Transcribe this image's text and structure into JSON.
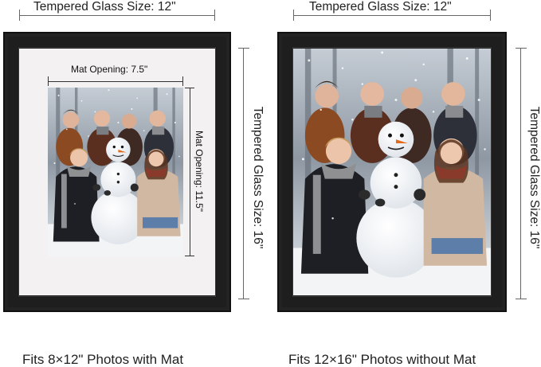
{
  "left": {
    "glass_width_label": "Tempered Glass Size: 12\"",
    "glass_height_label": "Tempered Glass Size: 16\"",
    "mat_width_label": "Mat Opening: 7.5\"",
    "mat_height_label": "Mat Opening: 11.5\"",
    "caption": "Fits 8×12\" Photos with Mat"
  },
  "right": {
    "glass_width_label": "Tempered Glass Size: 12\"",
    "glass_height_label": "Tempered Glass Size: 16\"",
    "caption": "Fits 12×16\" Photos without Mat"
  },
  "colors": {
    "frame": "#1b1b1b",
    "mat": "#f4f1f2",
    "dimension_line": "#666666"
  }
}
